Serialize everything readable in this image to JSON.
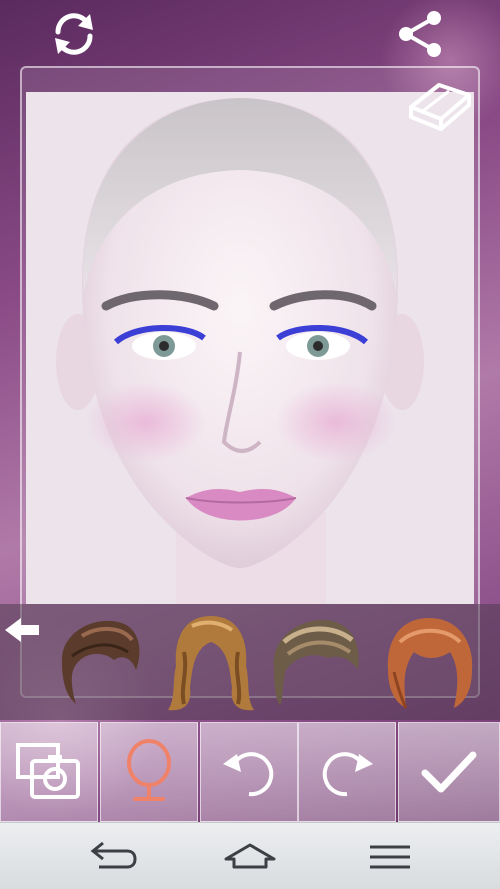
{
  "top_bar": {
    "refresh_icon": "refresh-icon",
    "share_icon": "share-icon"
  },
  "canvas": {
    "eraser_icon": "eraser-icon",
    "photo": "face-photo"
  },
  "hair_strip": {
    "back_icon": "arrow-left-icon",
    "items": [
      {
        "icon": "hairstyle-short-dark"
      },
      {
        "icon": "hairstyle-long-wavy"
      },
      {
        "icon": "hairstyle-quiff"
      },
      {
        "icon": "hairstyle-auburn-bob"
      }
    ]
  },
  "toolbar": {
    "buttons": [
      {
        "icon": "gallery-camera-icon"
      },
      {
        "icon": "mirror-icon",
        "color": "#f0826a"
      },
      {
        "icon": "undo-icon"
      },
      {
        "icon": "redo-icon"
      },
      {
        "icon": "check-icon"
      }
    ]
  },
  "navbar": {
    "buttons": [
      {
        "icon": "back-icon"
      },
      {
        "icon": "home-icon"
      },
      {
        "icon": "menu-icon"
      }
    ]
  },
  "colors": {
    "background_top": "#5a2a5e",
    "background_mid": "#b07aa8",
    "navbar": "#e4e6e8"
  }
}
